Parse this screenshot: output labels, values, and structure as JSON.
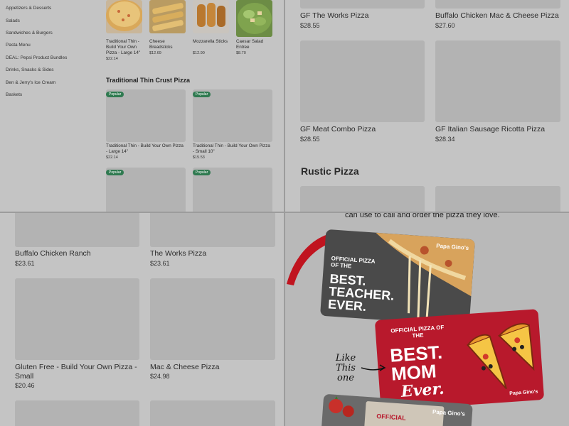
{
  "sidebar": {
    "categories": [
      "Appetizers & Desserts",
      "Salads",
      "Sandwiches & Burgers",
      "Pasta Menu",
      "DEAL: Pepsi Product Bundles",
      "Drinks, Snacks & Sides",
      "Ben & Jerry's Ice Cream",
      "Baskets"
    ]
  },
  "top_items": [
    {
      "name": "Traditional Thin - Build Your Own Pizza - Large 14\"",
      "price": "$22.14"
    },
    {
      "name": "Cheese Breadsticks",
      "price": "$12.69"
    },
    {
      "name": "Mozzarella Sticks",
      "price": "$12.90"
    },
    {
      "name": "Caesar Salad Entree",
      "price": "$8.70"
    }
  ],
  "thin_section": {
    "heading": "Traditional Thin Crust Pizza",
    "badge": "Popular",
    "items": [
      {
        "name": "Traditional Thin - Build Your Own Pizza - Large 14\"",
        "price": "$22.14"
      },
      {
        "name": "Traditional Thin - Build Your Own Pizza - Small 10\"",
        "price": "$15.53"
      }
    ]
  },
  "gf_items": [
    {
      "name": "GF The Works Pizza",
      "price": "$28.55"
    },
    {
      "name": "Buffalo Chicken Mac & Cheese Pizza",
      "price": "$27.60"
    },
    {
      "name": "GF Meat Combo Pizza",
      "price": "$28.55"
    },
    {
      "name": "GF Italian Sausage Ricotta Pizza",
      "price": "$28.34"
    }
  ],
  "rustic_heading": "Rustic Pizza",
  "q3_items": [
    {
      "name": "Buffalo Chicken Ranch",
      "price": "$23.61"
    },
    {
      "name": "The Works Pizza",
      "price": "$23.61"
    },
    {
      "name": "Gluten Free -  Build Your Own Pizza - Small",
      "price": "$20.46"
    },
    {
      "name": "Mac & Cheese Pizza",
      "price": "$24.98"
    }
  ],
  "promo": {
    "caption": "can use to call and order the pizza they love.",
    "brand": "Papa Gino's",
    "teacher_small": "OFFICIAL PIZZA OF THE",
    "teacher_big": "BEST. TEACHER. EVER.",
    "mom_small": "OFFICIAL PIZZA OF THE",
    "mom_big_1": "BEST.",
    "mom_big_2": "MOM",
    "mom_script": "Ever.",
    "annotation": "Like This one",
    "third_small": "OFFICIAL"
  },
  "colors": {
    "badge": "#2f7a50",
    "mom_card": "#b8192c",
    "teacher_card": "#4a4a4a"
  }
}
